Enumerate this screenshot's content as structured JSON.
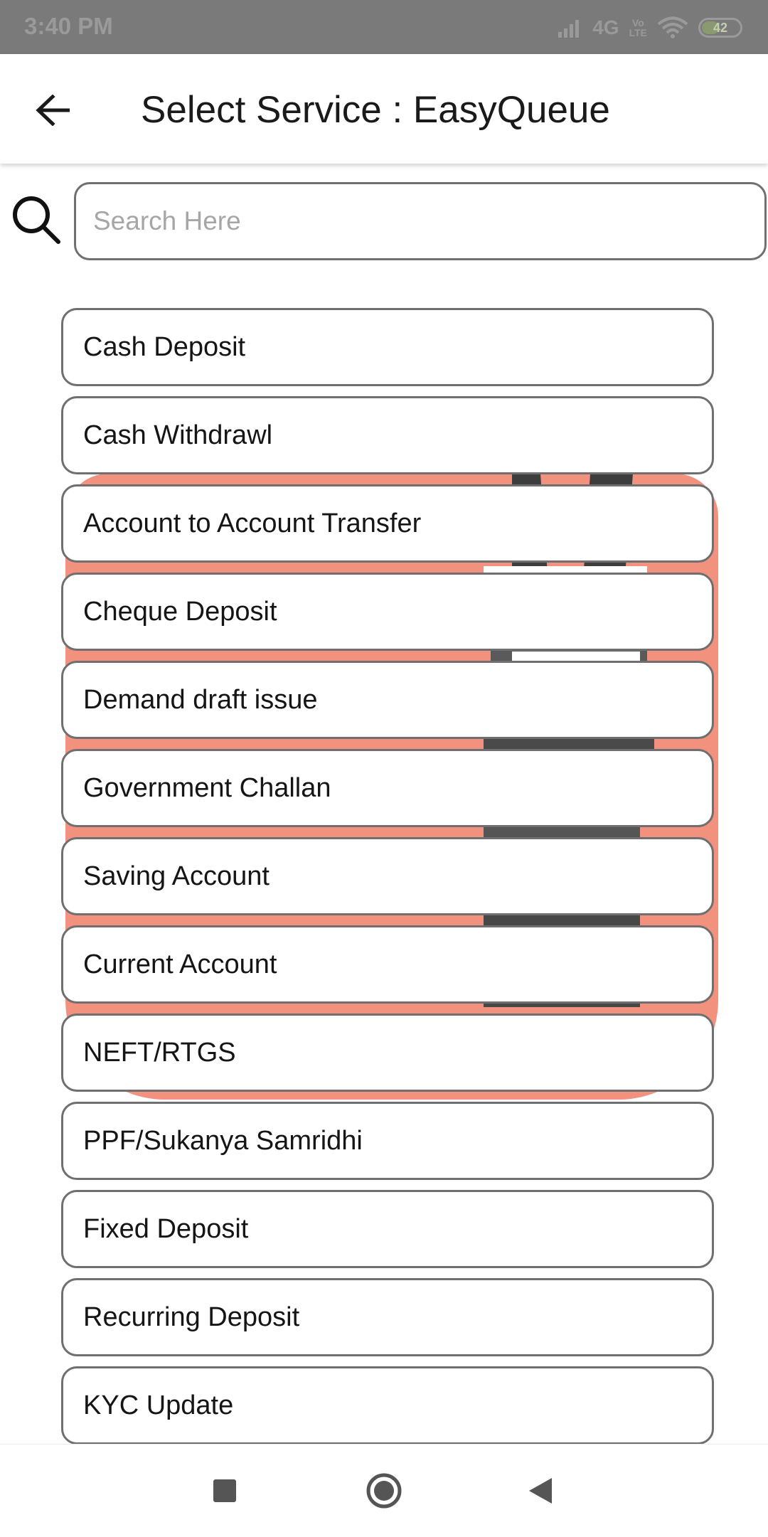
{
  "status_bar": {
    "time": "3:40 PM",
    "network": "4G",
    "volte_top": "Vo",
    "volte_bottom": "LTE",
    "battery": "42",
    "battery_level": 0.42
  },
  "app_bar": {
    "title": "Select Service : EasyQueue"
  },
  "search": {
    "placeholder": "Search Here",
    "value": ""
  },
  "services": [
    "Cash Deposit",
    "Cash Withdrawl",
    "Account to Account Transfer",
    "Cheque Deposit",
    "Demand draft issue",
    "Government Challan",
    "Saving Account",
    "Current Account",
    "NEFT/RTGS",
    "PPF/Sukanya Samridhi",
    "Fixed Deposit",
    "Recurring Deposit",
    "KYC Update"
  ],
  "icons": {
    "back": "arrow-left-icon",
    "search": "search-icon",
    "nav_recents": "square-icon",
    "nav_home": "circle-icon",
    "nav_back": "triangle-left-icon"
  },
  "colors": {
    "status_bar": "#7a7a7a",
    "background_art": "#f2927e",
    "border": "#6f6f6f",
    "text": "#151515"
  }
}
